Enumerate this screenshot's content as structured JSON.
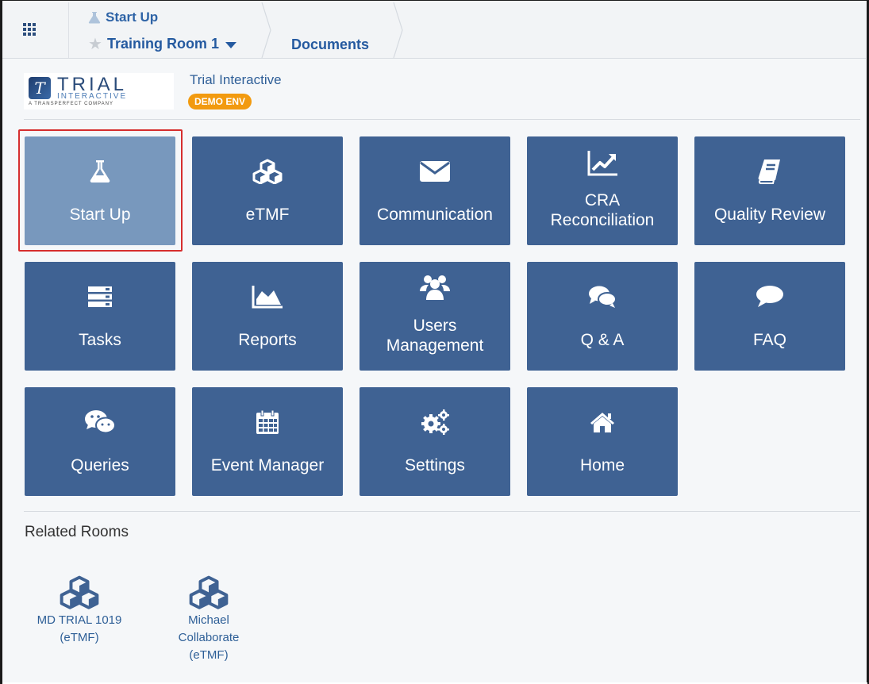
{
  "nav": {
    "crumb_top": "Start Up",
    "room": "Training Room 1",
    "documents": "Documents"
  },
  "header": {
    "app_name": "Trial Interactive",
    "badge": "DEMO ENV",
    "logo_line1": "TRIAL",
    "logo_line2": "INTERACTIVE",
    "logo_line3": "A TRANSPERFECT COMPANY"
  },
  "tiles": [
    {
      "label": "Start Up",
      "icon": "flask-icon",
      "selected": true
    },
    {
      "label": "eTMF",
      "icon": "cubes-icon"
    },
    {
      "label": "Communication",
      "icon": "envelope-icon"
    },
    {
      "label_line1": "CRA",
      "label_line2": "Reconciliation",
      "icon": "line-chart-icon"
    },
    {
      "label": "Quality Review",
      "icon": "book-icon"
    },
    {
      "label": "Tasks",
      "icon": "server-icon"
    },
    {
      "label": "Reports",
      "icon": "area-chart-icon"
    },
    {
      "label_line1": "Users",
      "label_line2": "Management",
      "icon": "users-icon"
    },
    {
      "label": "Q & A",
      "icon": "comments-icon"
    },
    {
      "label": "FAQ",
      "icon": "comment-icon"
    },
    {
      "label": "Queries",
      "icon": "wechat-icon"
    },
    {
      "label": "Event Manager",
      "icon": "calendar-icon"
    },
    {
      "label": "Settings",
      "icon": "gears-icon"
    },
    {
      "label": "Home",
      "icon": "home-icon"
    }
  ],
  "related": {
    "title": "Related Rooms",
    "rooms": [
      {
        "line1": "MD TRIAL 1019",
        "line2": "(eTMF)",
        "icon": "cubes-icon"
      },
      {
        "line1": "Michael",
        "line2": "Collaborate",
        "line3": "(eTMF)",
        "icon": "cubes-icon"
      }
    ]
  },
  "colors": {
    "tile": "#3f6293",
    "tile_selected": "#7898bd",
    "link": "#255aa0",
    "badge": "#f29a0f",
    "highlight": "#d62e2e"
  }
}
